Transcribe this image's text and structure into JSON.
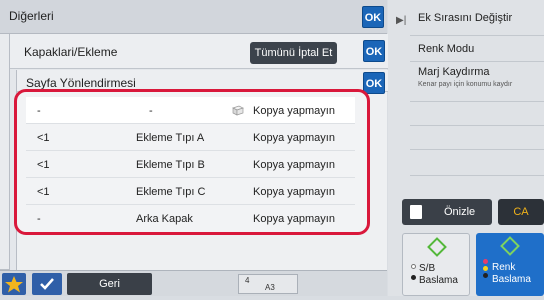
{
  "dialog_main": {
    "title": "Diğerleri",
    "ok_label": "OK"
  },
  "dialog_covers": {
    "title": "Kapaklari/Ekleme",
    "cancel_all_label": "Tümünü İptal Et",
    "ok_label": "OK"
  },
  "dialog_orientation": {
    "title": "Sayfa Yönlendirmesi",
    "ok_label": "OK"
  },
  "insert_table": {
    "rows": [
      {
        "page": "-",
        "type": "-",
        "copy": "Kopya yapmayın",
        "icon": "page-icon"
      },
      {
        "page": "<1",
        "type": "Ekleme Tıpı A",
        "copy": "Kopya yapmayın"
      },
      {
        "page": "<1",
        "type": "Ekleme Tıpı B",
        "copy": "Kopya yapmayın"
      },
      {
        "page": "<1",
        "type": "Ekleme Tıpı C",
        "copy": "Kopya yapmayın"
      },
      {
        "page": "-",
        "type": "Arka Kapak",
        "copy": "Kopya yapmayın"
      }
    ],
    "highlight_color": "#d9183b"
  },
  "bottom_bar": {
    "back_label": "Geri",
    "page_count": "4",
    "paper_size": "A3"
  },
  "right_panel": {
    "items": [
      {
        "label": "Ek Sırasını Değiştir"
      },
      {
        "label": "Renk Modu"
      },
      {
        "label": "Marj Kaydırma",
        "sub": "Kenar payı için konumu kaydır"
      }
    ],
    "preview_label": "Önizle",
    "ca_label": "CA",
    "start_bw": {
      "line1": "S/B",
      "line2": "Baslama"
    },
    "start_color": {
      "line1": "Renk",
      "line2": "Baslama"
    }
  },
  "colors": {
    "ok_blue": "#1b66b8",
    "start_color_blue": "#1f6fc9",
    "ca_text": "#f0b21a",
    "start_green": "#53b83a"
  }
}
